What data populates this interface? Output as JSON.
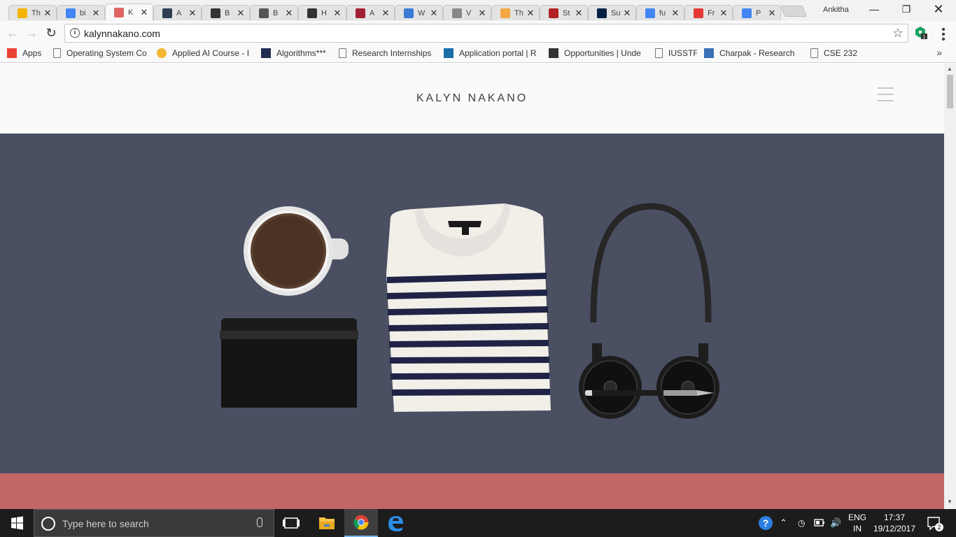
{
  "browser": {
    "tabs": [
      {
        "title": "Th",
        "icon": "slides-icon",
        "color": "#f4b400",
        "active": false
      },
      {
        "title": "bi",
        "icon": "google-icon",
        "color": "#4285f4",
        "active": false
      },
      {
        "title": "K",
        "icon": "kalyn-site-icon",
        "color": "#e06464",
        "active": true
      },
      {
        "title": "A",
        "icon": "site-logo-icon",
        "color": "#2c3e50",
        "active": false
      },
      {
        "title": "B",
        "icon": "terminal-icon",
        "color": "#333333",
        "active": false
      },
      {
        "title": "B",
        "icon": "avatar-icon",
        "color": "#555555",
        "active": false
      },
      {
        "title": "H",
        "icon": "site-logo-icon",
        "color": "#333333",
        "active": false
      },
      {
        "title": "A",
        "icon": "library-icon",
        "color": "#a31f34",
        "active": false
      },
      {
        "title": "W",
        "icon": "c-logo-icon",
        "color": "#3a7bd5",
        "active": false
      },
      {
        "title": "V",
        "icon": "page-icon",
        "color": "#888888",
        "active": false
      },
      {
        "title": "Th",
        "icon": "cloud-icon",
        "color": "#f4a742",
        "active": false
      },
      {
        "title": "St",
        "icon": "s-logo-icon",
        "color": "#b22222",
        "active": false
      },
      {
        "title": "Su",
        "icon": "ubc-logo-icon",
        "color": "#002145",
        "active": false
      },
      {
        "title": "fu",
        "icon": "loading-icon",
        "color": "#4285f4",
        "active": false
      },
      {
        "title": "Fr",
        "icon": "f-logo-icon",
        "color": "#e53935",
        "active": false
      },
      {
        "title": "P",
        "icon": "dot-icon",
        "color": "#4285f4",
        "active": false
      }
    ],
    "profile_name": "Ankitha",
    "url": "kalynnakano.com",
    "extension_badge": "1",
    "bookmarks": [
      {
        "label": "Apps",
        "icon": "apps-grid-icon"
      },
      {
        "label": "Operating System Co",
        "icon": "page-icon"
      },
      {
        "label": "Applied AI Course - I",
        "icon": "ai-course-icon"
      },
      {
        "label": "Algorithms***",
        "icon": "h-logo-icon"
      },
      {
        "label": "Research Internships",
        "icon": "page-icon"
      },
      {
        "label": "Application portal | R",
        "icon": "dj-logo-icon"
      },
      {
        "label": "Opportunities | Unde",
        "icon": "cal-logo-icon"
      },
      {
        "label": "IUSSTF",
        "icon": "page-icon"
      },
      {
        "label": "Charpak - Research Ir",
        "icon": "checker-icon"
      },
      {
        "label": "CSE 232",
        "icon": "page-icon"
      }
    ]
  },
  "site": {
    "title": "KALYN NAKANO",
    "colors": {
      "hero": "#4b4f62",
      "band": "#c26666"
    }
  },
  "taskbar": {
    "search_placeholder": "Type here to search",
    "language": "ENG",
    "region": "IN",
    "time": "17:37",
    "date": "19/12/2017",
    "notifications": "2"
  }
}
